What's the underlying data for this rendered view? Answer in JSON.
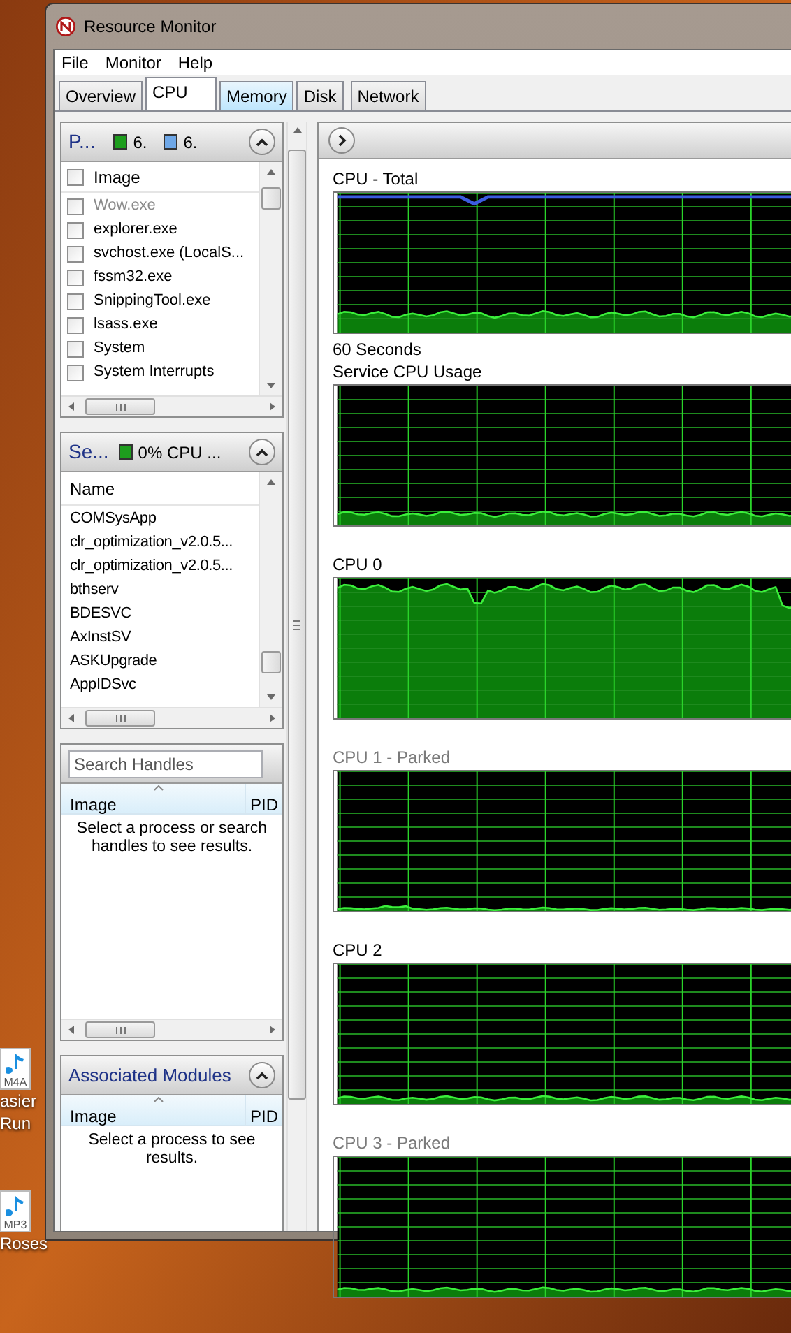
{
  "window": {
    "title": "Resource Monitor"
  },
  "menu": [
    "File",
    "Monitor",
    "Help"
  ],
  "tabs": [
    {
      "label": "Overview",
      "selected": false,
      "highlighted": false
    },
    {
      "label": "CPU",
      "selected": true,
      "highlighted": false
    },
    {
      "label": "Memory",
      "selected": false,
      "highlighted": true
    },
    {
      "label": "Disk",
      "selected": false,
      "highlighted": false
    },
    {
      "label": "Network",
      "selected": false,
      "highlighted": false
    }
  ],
  "processes": {
    "title": "P...",
    "expanded": true,
    "legend": [
      {
        "text": "6.",
        "color": "#1e9e1e"
      },
      {
        "text": "6.",
        "color": "#6fa8e8"
      }
    ],
    "header_checked": false,
    "column": "Image",
    "rows": [
      {
        "name": "Wow.exe",
        "checked": false,
        "dimmed": true
      },
      {
        "name": "explorer.exe",
        "checked": false,
        "dimmed": false
      },
      {
        "name": "svchost.exe (LocalS...",
        "checked": false,
        "dimmed": false
      },
      {
        "name": "fssm32.exe",
        "checked": false,
        "dimmed": false
      },
      {
        "name": "SnippingTool.exe",
        "checked": false,
        "dimmed": false
      },
      {
        "name": "lsass.exe",
        "checked": false,
        "dimmed": false
      },
      {
        "name": "System",
        "checked": false,
        "dimmed": false
      },
      {
        "name": "System Interrupts",
        "checked": false,
        "dimmed": false
      }
    ]
  },
  "services": {
    "title": "Se...",
    "expanded": true,
    "legend": [
      {
        "text": "0% CPU ...",
        "color": "#1e9e1e"
      }
    ],
    "column": "Name",
    "rows": [
      "COMSysApp",
      "clr_optimization_v2.0.5...",
      "clr_optimization_v2.0.5...",
      "bthserv",
      "BDESVC",
      "AxInstSV",
      "ASKUpgrade",
      "AppIDSvc"
    ]
  },
  "handles": {
    "search_placeholder": "Search Handles",
    "columns": [
      "Image",
      "PID"
    ],
    "message": "Select a process or search handles to see results."
  },
  "modules": {
    "title": "Associated Modules",
    "expanded": true,
    "columns": [
      "Image",
      "PID"
    ],
    "message": "Select a process to see results."
  },
  "charts": [
    {
      "label": "CPU - Total",
      "dimmed": false,
      "caption": "60 Seconds"
    },
    {
      "label": "Service CPU Usage",
      "dimmed": false
    },
    {
      "label": "CPU 0",
      "dimmed": false
    },
    {
      "label": "CPU 1 - Parked",
      "dimmed": true
    },
    {
      "label": "CPU 2",
      "dimmed": false
    },
    {
      "label": "CPU 3 - Parked",
      "dimmed": true
    }
  ],
  "desktop_icons": [
    {
      "badge": "M4A",
      "label_lines": [
        "asier",
        "Run"
      ]
    },
    {
      "badge": "MP3",
      "label_lines": [
        "Roses"
      ]
    }
  ]
}
